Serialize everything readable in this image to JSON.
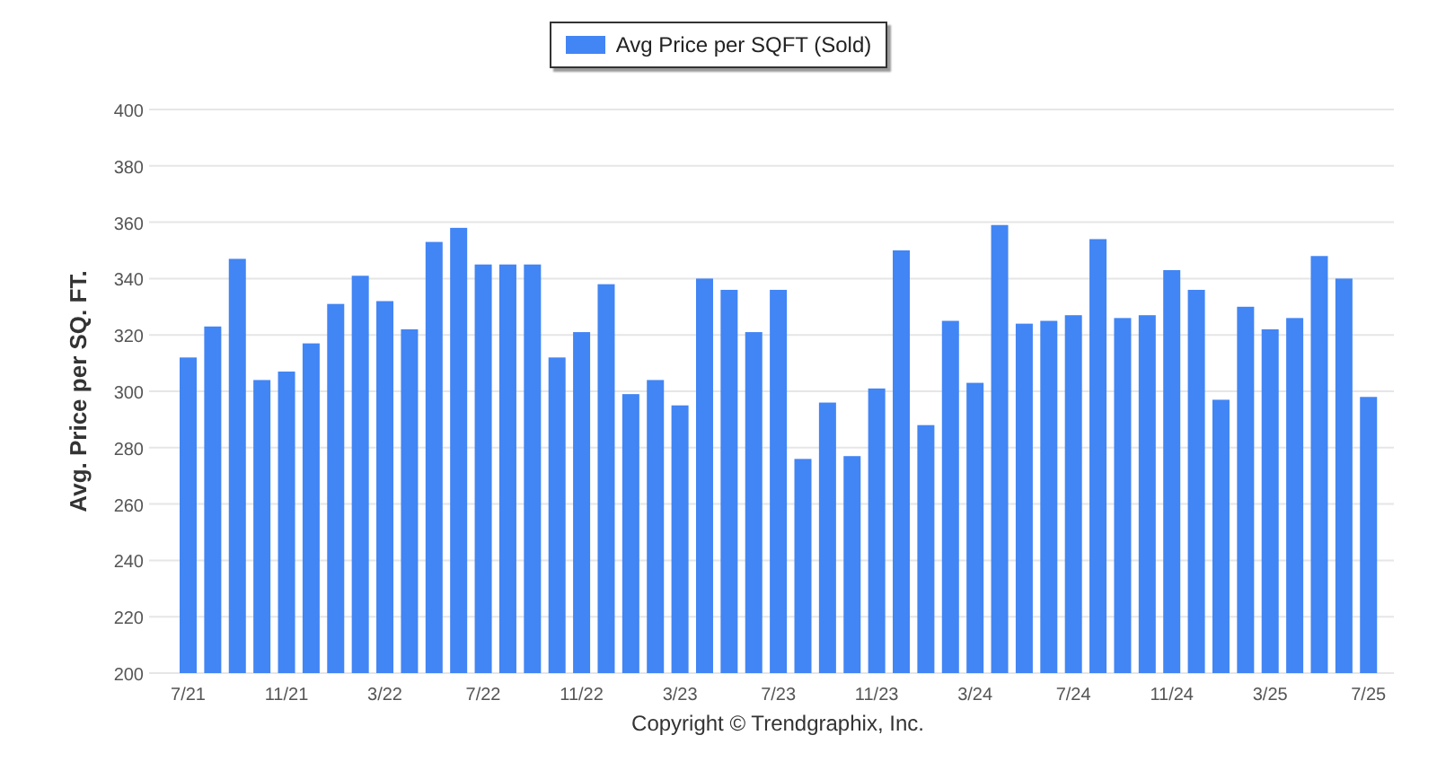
{
  "chart_data": {
    "type": "bar",
    "ylabel": "Avg. Price per SQ. FT.",
    "ylim": [
      200,
      400
    ],
    "yticks": [
      200,
      220,
      240,
      260,
      280,
      300,
      320,
      340,
      360,
      380,
      400
    ],
    "grid": true,
    "categories": [
      "7/21",
      null,
      null,
      null,
      "11/21",
      null,
      null,
      null,
      "3/22",
      null,
      null,
      null,
      "7/22",
      null,
      null,
      null,
      "11/22",
      null,
      null,
      null,
      "3/23",
      null,
      null,
      null,
      "7/23",
      null,
      null,
      null,
      "11/23",
      null,
      null,
      null,
      "3/24",
      null,
      null,
      null,
      "7/24",
      null,
      null,
      null,
      "11/24",
      null,
      null,
      null,
      "3/25",
      null,
      null,
      null,
      "7/25"
    ],
    "series": [
      {
        "name": "Avg Price per SQFT (Sold)",
        "color": "#4285f4",
        "values": [
          312,
          323,
          347,
          304,
          307,
          317,
          331,
          341,
          332,
          322,
          353,
          358,
          345,
          345,
          345,
          312,
          321,
          338,
          299,
          304,
          295,
          340,
          336,
          321,
          336,
          276,
          296,
          277,
          301,
          350,
          288,
          325,
          303,
          359,
          324,
          325,
          327,
          354,
          326,
          327,
          343,
          336,
          297,
          330,
          322,
          326,
          348,
          340,
          298
        ]
      }
    ]
  },
  "footer": "Copyright © Trendgraphix, Inc."
}
